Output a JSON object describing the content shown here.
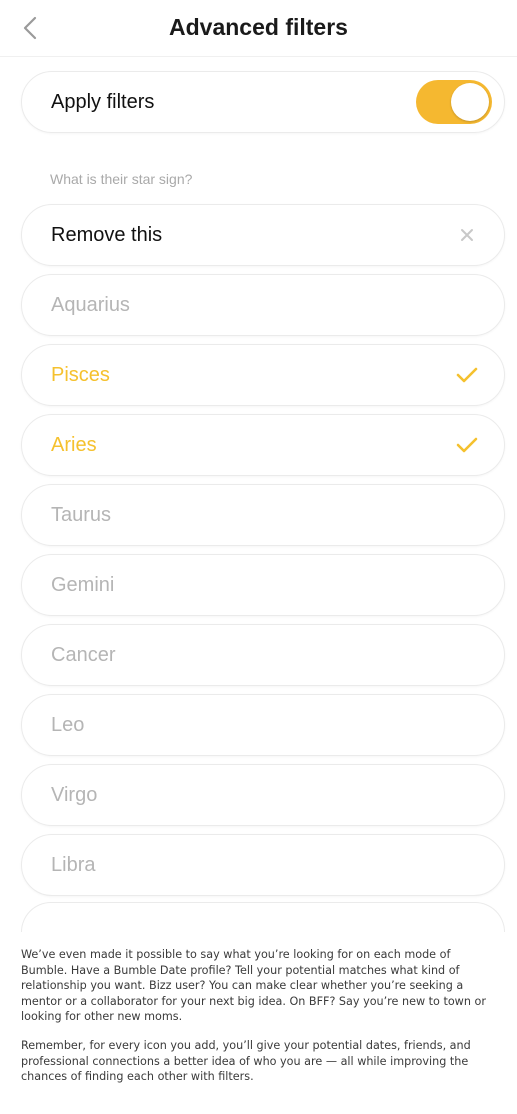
{
  "header": {
    "title": "Advanced filters"
  },
  "apply_filters": {
    "label": "Apply filters",
    "enabled": true,
    "toggle_color": "#f5b830"
  },
  "star_sign": {
    "question": "What is their star sign?",
    "remove_label": "Remove this",
    "options": [
      {
        "label": "Aquarius",
        "selected": false
      },
      {
        "label": "Pisces",
        "selected": true
      },
      {
        "label": "Aries",
        "selected": true
      },
      {
        "label": "Taurus",
        "selected": false
      },
      {
        "label": "Gemini",
        "selected": false
      },
      {
        "label": "Cancer",
        "selected": false
      },
      {
        "label": "Leo",
        "selected": false
      },
      {
        "label": "Virgo",
        "selected": false
      },
      {
        "label": "Libra",
        "selected": false
      }
    ],
    "selected_color": "#f5c12e"
  },
  "body_text": {
    "paragraph_1": "We’ve even made it possible to say what you’re looking for on each mode of Bumble. Have a Bumble Date profile? Tell your potential matches what kind of relationship you want. Bizz user? You can make clear whether you’re seeking a mentor or a collaborator for your next big idea. On BFF? Say you’re new to town or looking for other new moms.",
    "paragraph_2": "Remember, for every icon you add, you’ll give your potential dates, friends, and professional connections a better idea of who you are — all while improving the chances of finding each other with filters."
  }
}
